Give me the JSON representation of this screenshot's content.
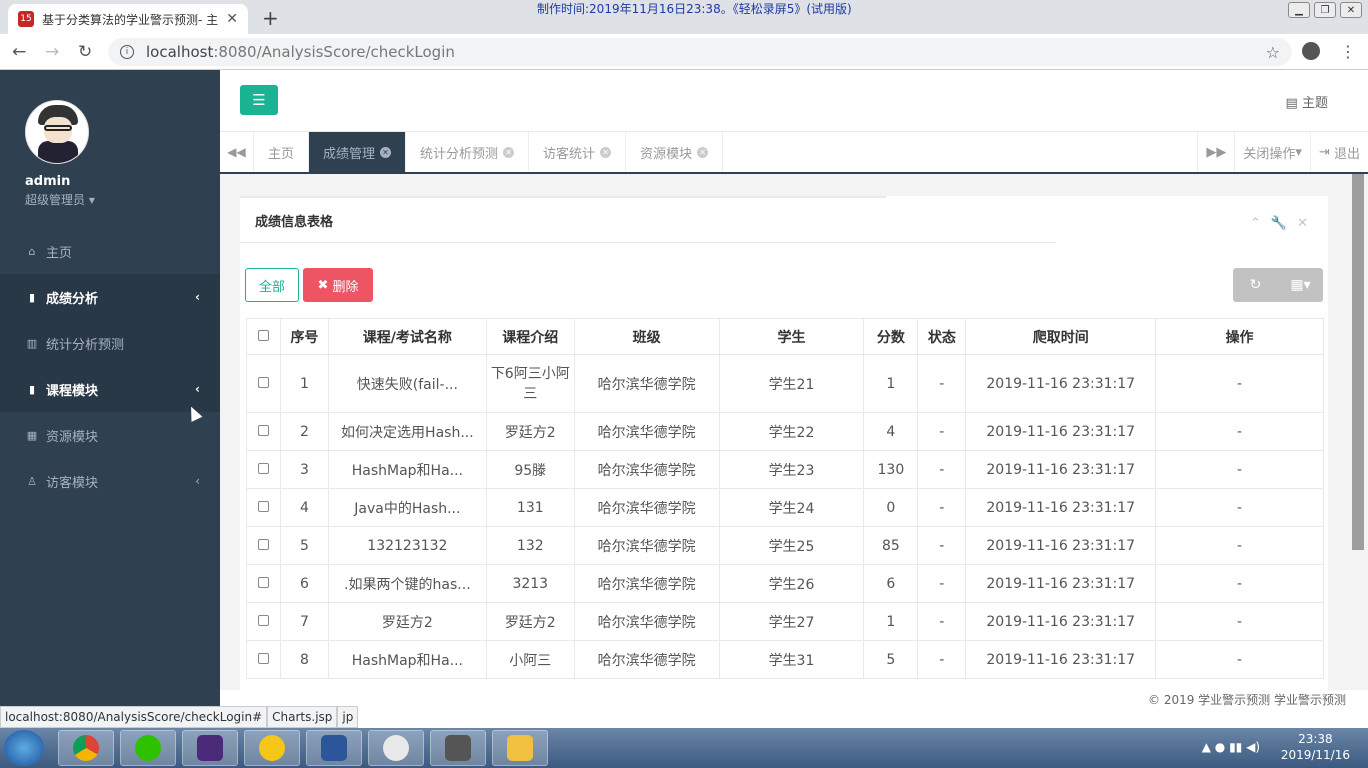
{
  "browser": {
    "tab_title": "基于分类算法的学业警示预测- 主",
    "tab_icon": "15",
    "recording_banner": "制作时间:2019年11月16日23:38。《轻松录屏5》(试用版)",
    "url_host": "localhost",
    "url_rest": ":8080/AnalysisScore/checkLogin",
    "status_url": "localhost:8080/AnalysisScore/checkLogin#",
    "status_extra1": "Charts.jsp",
    "status_extra2": "jp"
  },
  "sidebar": {
    "username": "admin",
    "role": "超级管理员",
    "items": [
      {
        "icon": "home-icon",
        "label": "主页"
      },
      {
        "icon": "book-icon",
        "label": "成绩分析"
      },
      {
        "icon": "bar-chart-icon",
        "label": "统计分析预测"
      },
      {
        "icon": "book-icon",
        "label": "课程模块"
      },
      {
        "icon": "table-icon",
        "label": "资源模块"
      },
      {
        "icon": "user-icon",
        "label": "访客模块"
      }
    ]
  },
  "topbar": {
    "theme_label": "主题"
  },
  "page_tabs": [
    {
      "label": "主页"
    },
    {
      "label": "成绩管理"
    },
    {
      "label": "统计分析预测"
    },
    {
      "label": "访客统计"
    },
    {
      "label": "资源模块"
    }
  ],
  "tab_actions": {
    "close_ops": "关闭操作",
    "logout": "退出"
  },
  "panel": {
    "title": "成绩信息表格",
    "btn_all": "全部",
    "btn_delete": "删除"
  },
  "table": {
    "headers": [
      "序号",
      "课程/考试名称",
      "课程介绍",
      "班级",
      "学生",
      "分数",
      "状态",
      "爬取时间",
      "操作"
    ],
    "rows": [
      [
        "1",
        "快速失败(fail-...",
        "下6阿三小阿三",
        "哈尔滨华德学院",
        "学生21",
        "1",
        "-",
        "2019-11-16 23:31:17",
        "-"
      ],
      [
        "2",
        "如何决定选用Hash...",
        "罗廷方2",
        "哈尔滨华德学院",
        "学生22",
        "4",
        "-",
        "2019-11-16 23:31:17",
        "-"
      ],
      [
        "3",
        "HashMap和Ha...",
        "95滕",
        "哈尔滨华德学院",
        "学生23",
        "130",
        "-",
        "2019-11-16 23:31:17",
        "-"
      ],
      [
        "4",
        "Java中的Hash...",
        "131",
        "哈尔滨华德学院",
        "学生24",
        "0",
        "-",
        "2019-11-16 23:31:17",
        "-"
      ],
      [
        "5",
        "132123132",
        "132",
        "哈尔滨华德学院",
        "学生25",
        "85",
        "-",
        "2019-11-16 23:31:17",
        "-"
      ],
      [
        "6",
        ".如果两个键的has...",
        "3213",
        "哈尔滨华德学院",
        "学生26",
        "6",
        "-",
        "2019-11-16 23:31:17",
        "-"
      ],
      [
        "7",
        "罗廷方2",
        "罗廷方2",
        "哈尔滨华德学院",
        "学生27",
        "1",
        "-",
        "2019-11-16 23:31:17",
        "-"
      ],
      [
        "8",
        "HashMap和Ha...",
        "小阿三",
        "哈尔滨华德学院",
        "学生31",
        "5",
        "-",
        "2019-11-16 23:31:17",
        "-"
      ]
    ]
  },
  "footer": {
    "text": "© 2019 学业警示预测 学业警示预测"
  },
  "taskbar": {
    "time": "23:38",
    "date": "2019/11/16"
  },
  "colors": {
    "accent": "#1ab394",
    "danger": "#ed5565",
    "sidebar": "#2f4050"
  }
}
